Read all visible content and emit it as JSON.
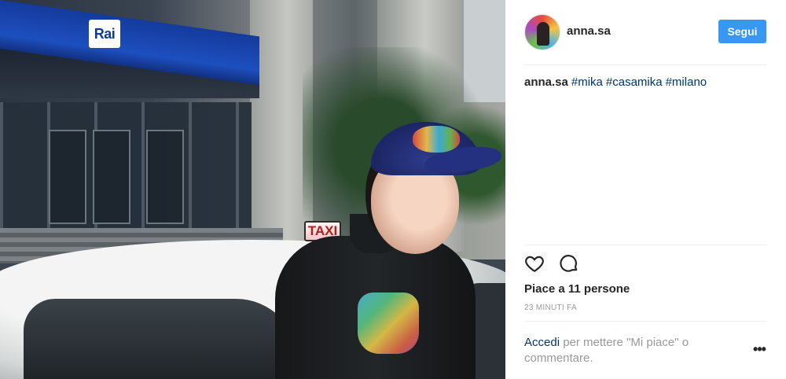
{
  "photo": {
    "alt_signs": {
      "rai_logo_text": "Rai",
      "taxi_sign_text": "TAXI"
    }
  },
  "header": {
    "username": "anna.sa",
    "follow_label": "Segui"
  },
  "caption": {
    "author": "anna.sa",
    "hashtags": [
      "#mika",
      "#casamika",
      "#milano"
    ]
  },
  "actions": {
    "like_icon": "heart-outline-icon",
    "comment_icon": "speech-bubble-icon"
  },
  "likes_text": "Piace a 11 persone",
  "timestamp": "23 MINUTI FA",
  "login_prompt": {
    "link_label": "Accedi",
    "rest_text": " per mettere \"Mi piace\" o commentare."
  },
  "more_label": "•••",
  "colors": {
    "accent_blue": "#3897f0",
    "link_blue": "#003569",
    "text_primary": "#262626",
    "text_muted": "#999999",
    "divider": "#efefef"
  }
}
